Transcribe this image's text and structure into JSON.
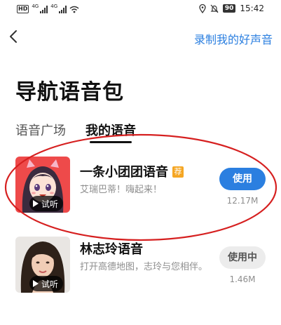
{
  "status_bar": {
    "hd_badge": "HD",
    "network_1": "4G",
    "network_2": "4G",
    "battery": "90",
    "time": "15:42",
    "icons": [
      "hd-icon",
      "signal-icon",
      "signal-icon",
      "wifi-icon",
      "location-icon",
      "mute-icon",
      "battery-icon"
    ]
  },
  "header": {
    "back_icon": "chevron-left-icon",
    "record_link": "录制我的好声音"
  },
  "page_title": "导航语音包",
  "tabs": [
    {
      "label": "语音广场",
      "active": false
    },
    {
      "label": "我的语音",
      "active": true
    }
  ],
  "voices": [
    {
      "name": "一条小团团语音",
      "badge": "荐",
      "description": "艾瑞巴蒂！嗨起来！",
      "preview_label": "试听",
      "button_label": "使用",
      "size": "12.17M"
    },
    {
      "name": "林志玲语音",
      "description": "打开高德地图，志玲与您相伴。",
      "preview_label": "试听",
      "button_label": "使用中",
      "size": "1.46M"
    }
  ],
  "colors": {
    "accent": "#2b7fe0",
    "badge": "#f5a623",
    "annotation": "#d62020"
  }
}
